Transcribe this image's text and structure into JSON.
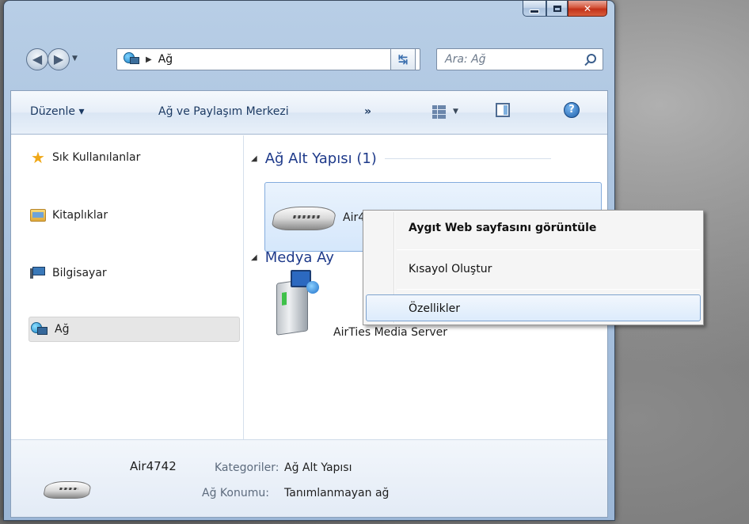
{
  "window": {
    "caption_buttons": [
      "minimize",
      "maximize",
      "close"
    ]
  },
  "nav": {
    "address_location": "Ağ",
    "search_placeholder": "Ara: Ağ"
  },
  "toolbar": {
    "organize": "Düzenle ▾",
    "network_center": "Ağ ve Paylaşım Merkezi",
    "more": "»"
  },
  "sidebar": {
    "items": [
      {
        "label": "Sık Kullanılanlar",
        "icon": "star-icon"
      },
      {
        "label": "Kitaplıklar",
        "icon": "libraries-icon"
      },
      {
        "label": "Bilgisayar",
        "icon": "computer-icon"
      },
      {
        "label": "Ağ",
        "icon": "network-icon",
        "selected": true
      }
    ]
  },
  "groups": [
    {
      "title": "Ağ Alt Yapısı (1)",
      "items": [
        {
          "label": "Air4742"
        }
      ]
    },
    {
      "title": "Medya Aygıtları",
      "visible_title": "Medya Ay",
      "items": [
        {
          "label": "AirTies Media Server",
          "visible_label": "AirTies Media Server"
        }
      ]
    }
  ],
  "details": {
    "name": "Air4742",
    "category_key": "Kategoriler:",
    "category_value": "Ağ Alt Yapısı",
    "location_key": "Ağ Konumu:",
    "location_value": "Tanımlanmayan ağ"
  },
  "context_menu": {
    "items": [
      {
        "label": "Aygıt Web sayfasını görüntüle",
        "bold": true
      },
      {
        "label": "Kısayol Oluştur"
      },
      {
        "label": "Özellikler",
        "hovered": true
      }
    ]
  },
  "colors": {
    "accent": "#1e3a8a",
    "selection": "#dcebfc",
    "close_button": "#c2321a"
  }
}
